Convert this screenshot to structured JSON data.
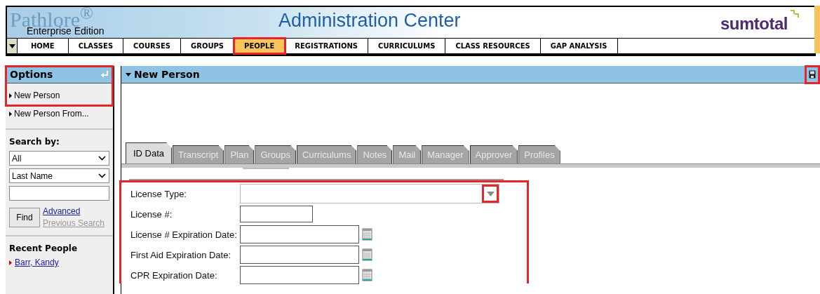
{
  "header": {
    "logo_watermark": "Pathlore$^{®}$",
    "edition": "Enterprise Edition",
    "title": "Administration Center",
    "brand": "sumtotal"
  },
  "nav": [
    {
      "label": "HOME",
      "selected": false,
      "highlighted": false
    },
    {
      "label": "CLASSES",
      "selected": false,
      "highlighted": false
    },
    {
      "label": "COURSES",
      "selected": false,
      "highlighted": false
    },
    {
      "label": "GROUPS",
      "selected": false,
      "highlighted": false
    },
    {
      "label": "PEOPLE",
      "selected": true,
      "highlighted": true
    },
    {
      "label": "REGISTRATIONS",
      "selected": false,
      "highlighted": false
    },
    {
      "label": "CURRICULUMS",
      "selected": false,
      "highlighted": false
    },
    {
      "label": "CLASS RESOURCES",
      "selected": false,
      "highlighted": false
    },
    {
      "label": "GAP ANALYSIS",
      "selected": false,
      "highlighted": false
    }
  ],
  "sidebar": {
    "title": "Options",
    "highlighted": true,
    "options": [
      {
        "label": "New Person"
      },
      {
        "label": "New Person From..."
      }
    ],
    "search_label": "Search by:",
    "filter_1": "All",
    "filter_2": "Last Name",
    "find_button": "Find",
    "advanced_link": "Advanced",
    "previous_search": "Previous Search",
    "recent_title": "Recent People",
    "recent": [
      "Barr, Kandy"
    ]
  },
  "main": {
    "title": "New Person",
    "save_highlighted": true,
    "tabs": [
      {
        "label": "ID Data",
        "selected": true
      },
      {
        "label": "Transcript",
        "selected": false
      },
      {
        "label": "Plan",
        "selected": false
      },
      {
        "label": "Groups",
        "selected": false
      },
      {
        "label": "Curriculums",
        "selected": false
      },
      {
        "label": "Notes",
        "selected": false
      },
      {
        "label": "Mail",
        "selected": false
      },
      {
        "label": "Manager",
        "selected": false
      },
      {
        "label": "Approver",
        "selected": false
      },
      {
        "label": "Profiles",
        "selected": false
      }
    ],
    "form_highlighted": true,
    "fields": [
      {
        "label": "License Type:",
        "kind": "dropdown",
        "highlighted": true
      },
      {
        "label": "License #:",
        "kind": "short"
      },
      {
        "label": "License # Expiration Date:",
        "kind": "date"
      },
      {
        "label": "First Aid Expiration Date:",
        "kind": "date"
      },
      {
        "label": "CPR Expiration Date:",
        "kind": "date"
      }
    ]
  }
}
